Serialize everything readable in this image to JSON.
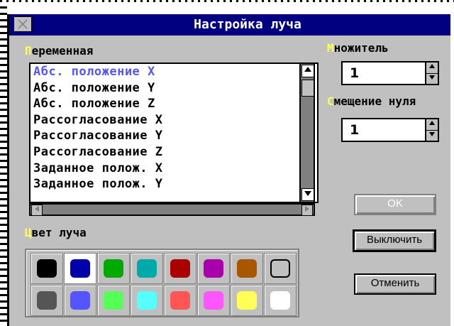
{
  "dialog": {
    "title": "Настройка луча"
  },
  "variable": {
    "label_hot": "П",
    "label_rest": "еременная",
    "items": [
      "Абс. положение X",
      "Абс. положение Y",
      "Абс. положение Z",
      "Рассогласование X",
      "Рассогласование Y",
      "Рассогласование Z",
      "Заданное полож. X",
      "Заданное полож. Y"
    ],
    "selected_index": 0
  },
  "multiplier": {
    "label_hot": "М",
    "label_rest": "ножитель",
    "value": "1"
  },
  "zero_offset": {
    "label_hot": "С",
    "label_rest": "мещение нуля",
    "value": "1"
  },
  "beam_color": {
    "label_hot": "Ц",
    "label_rest": "вет луча",
    "colors": [
      "#000000",
      "#0000aa",
      "#00aa00",
      "#00aaaa",
      "#aa0000",
      "#aa00aa",
      "#aa5500",
      "#c0c0c0",
      "#555555",
      "#5555ff",
      "#55ff55",
      "#55ffff",
      "#ff5555",
      "#ff55ff",
      "#ffff55",
      "#ffffff"
    ],
    "selected_index": 1
  },
  "buttons": {
    "ok": "OK",
    "disable": "Выключить",
    "cancel": "Отменить"
  },
  "icons": {
    "close": "close-icon",
    "scroll_up": "arrow-up-icon",
    "scroll_down": "arrow-down-icon",
    "scroll_left": "arrow-left-icon",
    "scroll_right": "arrow-right-icon"
  }
}
